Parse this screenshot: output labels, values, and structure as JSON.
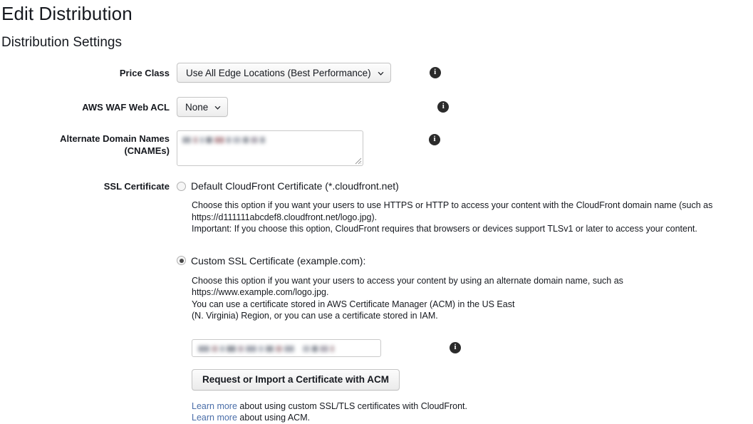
{
  "page": {
    "title": "Edit Distribution",
    "section_title": "Distribution Settings"
  },
  "fields": {
    "price_class": {
      "label": "Price Class",
      "value": "Use All Edge Locations (Best Performance)",
      "caret_icon": "chevron-down-icon",
      "info_icon": "info-icon",
      "info_glyph": "i"
    },
    "waf_acl": {
      "label": "AWS WAF Web ACL",
      "value": "None",
      "caret_icon": "chevron-down-icon",
      "info_icon": "info-icon",
      "info_glyph": "i"
    },
    "cnames": {
      "label_line1": "Alternate Domain Names",
      "label_line2": "(CNAMEs)",
      "value": "",
      "redacted": true,
      "info_icon": "info-icon",
      "info_glyph": "i",
      "resize_handle_icon": "resize-grip-icon"
    },
    "ssl_certificate": {
      "label": "SSL Certificate",
      "options": [
        {
          "id": "default-cloudfront-certificate",
          "label": "Default CloudFront Certificate (*.cloudfront.net)",
          "selected": false,
          "help_lines": [
            "Choose this option if you want your users to use HTTPS or HTTP to access your content with the CloudFront domain name (such as",
            "https://d111111abcdef8.cloudfront.net/logo.jpg).",
            "Important: If you choose this option, CloudFront requires that browsers or devices support TLSv1 or later to access your content."
          ]
        },
        {
          "id": "custom-ssl-certificate",
          "label": "Custom SSL Certificate (example.com):",
          "selected": true,
          "help_lines": [
            "Choose this option if you want your users to access your content by using an alternate domain name, such as https://www.example.com/logo.jpg.",
            "You can use a certificate stored in AWS Certificate Manager (ACM) in the US East",
            "(N. Virginia) Region, or you can use a certificate stored in IAM."
          ]
        }
      ],
      "certificate_select": {
        "value": "",
        "redacted": true,
        "info_icon": "info-icon",
        "info_glyph": "i"
      },
      "acm_button": "Request or Import a Certificate with ACM",
      "learn_more": [
        {
          "link_text": "Learn more",
          "rest": " about using custom SSL/TLS certificates with CloudFront."
        },
        {
          "link_text": "Learn more",
          "rest": " about using ACM."
        }
      ]
    }
  },
  "colors": {
    "text": "#16191f",
    "link": "#4a6ea9",
    "border": "#c4c4c4",
    "info_badge": "#2b2b2b"
  }
}
